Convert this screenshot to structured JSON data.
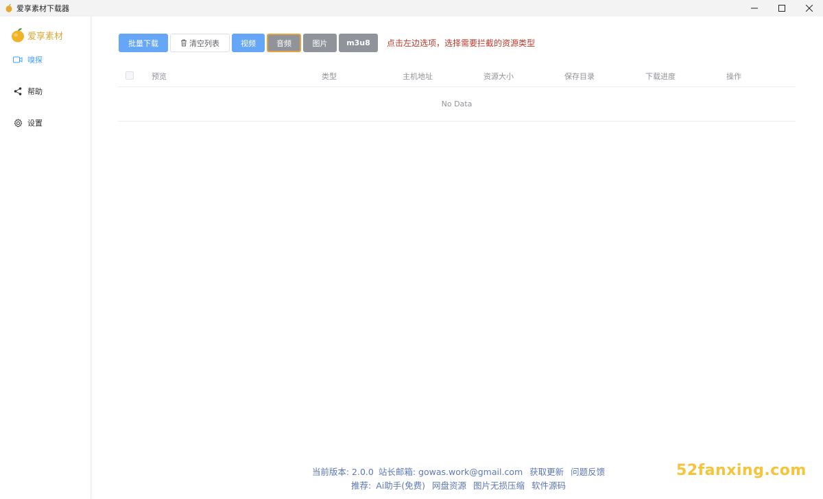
{
  "window": {
    "title": "爱享素材下载器"
  },
  "sidebar": {
    "brand": "爱享素材",
    "items": [
      {
        "label": "嗅探",
        "icon": "camera-icon",
        "active": true
      },
      {
        "label": "帮助",
        "icon": "share-icon",
        "active": false
      },
      {
        "label": "设置",
        "icon": "gear-icon",
        "active": false
      }
    ]
  },
  "toolbar": {
    "batch_download": "批量下载",
    "clear_list": "清空列表",
    "video": "视频",
    "audio": "音频",
    "image": "图片",
    "m3u8": "m3u8",
    "hint": "点击左边选项，选择需要拦截的资源类型"
  },
  "table": {
    "columns": [
      "预览",
      "类型",
      "主机地址",
      "资源大小",
      "保存目录",
      "下载进度",
      "操作"
    ],
    "empty_text": "No Data"
  },
  "footer": {
    "version": "当前版本: 2.0.0",
    "email": "站长邮箱: gowas.work@gmail.com",
    "update": "获取更新",
    "feedback": "问题反馈",
    "recommend_label": "推荐:",
    "links": [
      "Ai助手(免费)",
      "网盘资源",
      "图片无损压缩",
      "软件源码"
    ]
  },
  "watermark": "52fanxing.com",
  "colors": {
    "accent": "#409eff",
    "primary_button": "#66a6f7",
    "gray_button": "#909399",
    "selected_border": "#e6a23c",
    "hint": "#c0392b",
    "brand": "#d9a93a"
  }
}
